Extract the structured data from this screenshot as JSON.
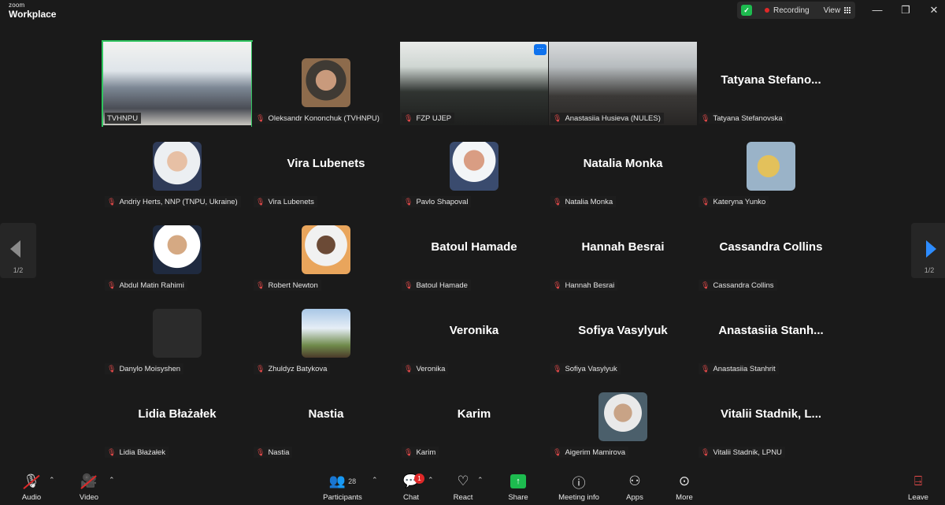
{
  "app": {
    "logo_line1": "zoom",
    "logo_line2": "Workplace"
  },
  "status": {
    "shield_icon": "shield-check-icon",
    "recording_label": "Recording",
    "view_label": "View"
  },
  "window_controls": {
    "minimize": "—",
    "restore": "❐",
    "close": "✕"
  },
  "tiles": [
    {
      "name": "TVHNPU",
      "display": "",
      "kind": "video"
    },
    {
      "name": "Oleksandr Kononchuk (TVHNPU)",
      "display": "",
      "kind": "avatar"
    },
    {
      "name": "FZP UJEP",
      "display": "",
      "kind": "video"
    },
    {
      "name": "Anastasiia Husieva (NULES)",
      "display": "",
      "kind": "video"
    },
    {
      "name": "Tatyana Stefanovska",
      "display": "Tatyana  Stefano...",
      "kind": "name"
    },
    {
      "name": "Andriy Herts, NNP (TNPU, Ukraine)",
      "display": "",
      "kind": "avatar"
    },
    {
      "name": "Vira Lubenets",
      "display": "Vira Lubenets",
      "kind": "name"
    },
    {
      "name": "Pavlo Shapoval",
      "display": "",
      "kind": "avatar"
    },
    {
      "name": "Natalia Monka",
      "display": "Natalia Monka",
      "kind": "name"
    },
    {
      "name": "Kateryna Yunko",
      "display": "",
      "kind": "avatar"
    },
    {
      "name": "Abdul Matin Rahimi",
      "display": "",
      "kind": "avatar"
    },
    {
      "name": "Robert Newton",
      "display": "",
      "kind": "avatar"
    },
    {
      "name": "Batoul Hamade",
      "display": "Batoul Hamade",
      "kind": "name"
    },
    {
      "name": "Hannah Besrai",
      "display": "Hannah Besrai",
      "kind": "name"
    },
    {
      "name": "Cassandra Collins",
      "display": "Cassandra Collins",
      "kind": "name"
    },
    {
      "name": "Danylo Moisyshen",
      "display": "",
      "kind": "avatar"
    },
    {
      "name": "Zhuldyz Batykova",
      "display": "",
      "kind": "avatar"
    },
    {
      "name": "Veronika",
      "display": "Veronika",
      "kind": "name"
    },
    {
      "name": "Sofiya Vasylyuk",
      "display": "Sofiya Vasylyuk",
      "kind": "name"
    },
    {
      "name": "Anastasiia Stanhrit",
      "display": "Anastasiia  Stanh...",
      "kind": "name"
    },
    {
      "name": "Lidia Błażałek",
      "display": "Lidia Błażałek",
      "kind": "name"
    },
    {
      "name": "Nastia",
      "display": "Nastia",
      "kind": "name"
    },
    {
      "name": "Karim",
      "display": "Karim",
      "kind": "name"
    },
    {
      "name": "Aigerim Mamirova",
      "display": "",
      "kind": "avatar"
    },
    {
      "name": "Vitalii Stadnik, LPNU",
      "display": "Vitalii Stadnik,  L...",
      "kind": "name"
    }
  ],
  "pagination": {
    "left_page": "1/2",
    "right_page": "1/2"
  },
  "toolbar": {
    "audio": "Audio",
    "video": "Video",
    "participants": "Participants",
    "participants_count": "28",
    "chat": "Chat",
    "chat_badge": "1",
    "react": "React",
    "share": "Share",
    "meeting_info": "Meeting info",
    "apps": "Apps",
    "more": "More",
    "leave": "Leave"
  },
  "colors": {
    "background": "#1a1a1a",
    "active_speaker": "#2fc45e",
    "mic_muted": "#e74a4a",
    "share_green": "#1dbb4f",
    "accent_blue": "#2d8cff"
  }
}
